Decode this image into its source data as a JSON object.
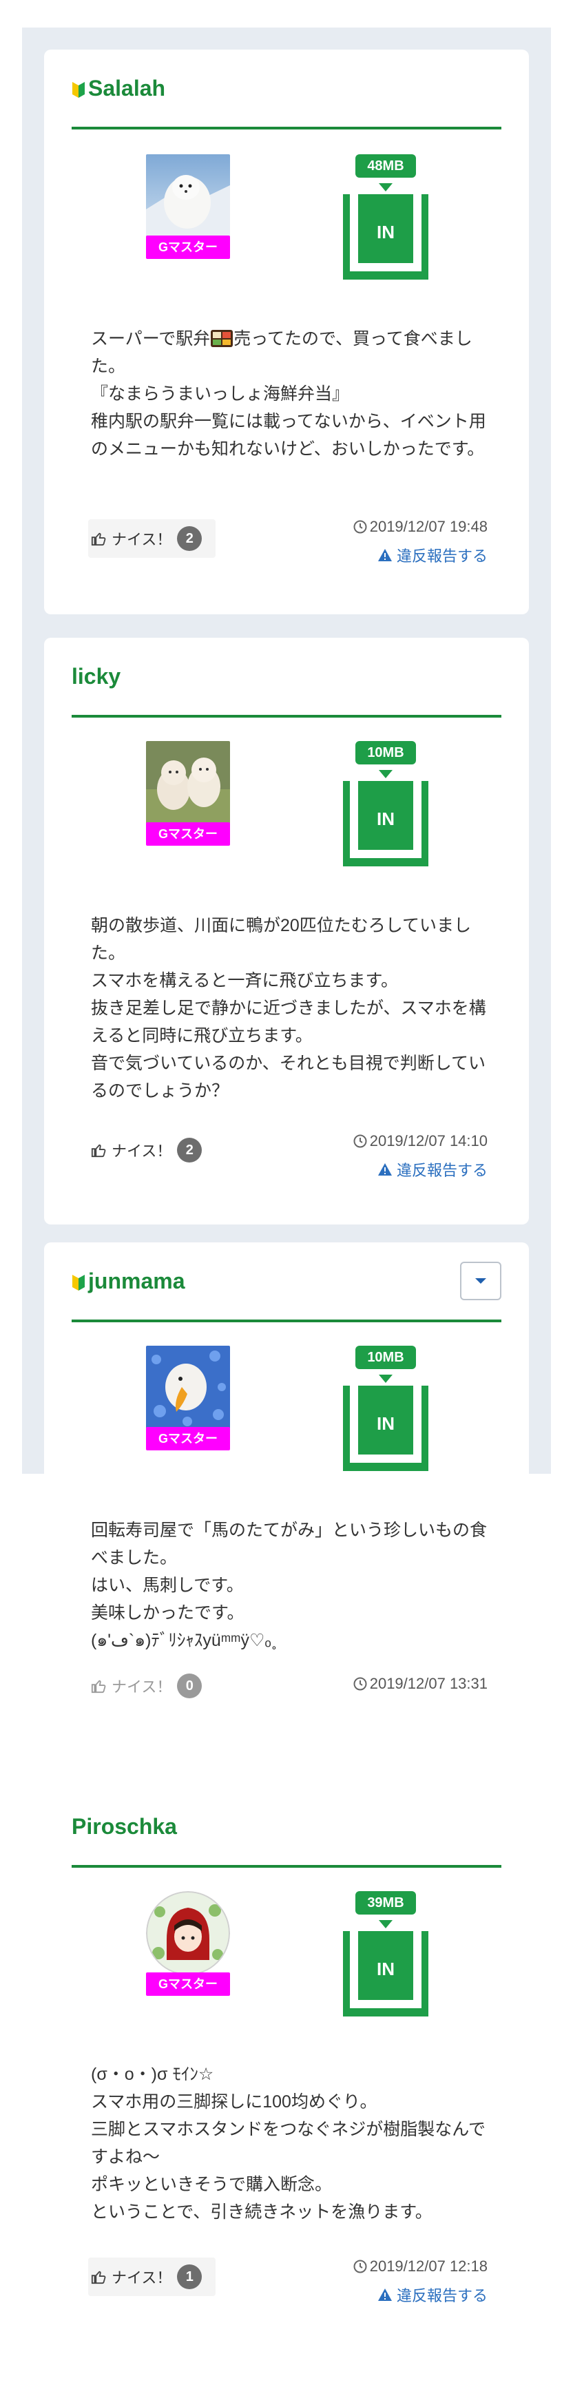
{
  "colors": {
    "accent_green": "#1b8a3a",
    "in_green": "#1e9e48",
    "badge_magenta": "#ff00ff",
    "link_blue": "#2b6fbf",
    "feed_background": "#e7ecf2"
  },
  "posts": [
    {
      "username": "Salalah",
      "beginner_mark": true,
      "rank": "Gマスター",
      "size": "48MB",
      "status": "IN",
      "body_pre_emoji": "スーパーで駅弁",
      "body_emoji_icon": "bento-box-icon",
      "body_post_emoji": "売ってたので、買って食べました。\n『なまらうまいっしょ海鮮弁当』\n稚内駅の駅弁一覧には載ってないから、イベント用のメニューかも知れないけど、おいしかったです。",
      "nice_label": "ナイス！",
      "nice_count": "2",
      "timestamp": "2019/12/07 19:48",
      "report_label": "違反報告する"
    },
    {
      "username": "licky",
      "beginner_mark": false,
      "rank": "Gマスター",
      "size": "10MB",
      "status": "IN",
      "body": "朝の散歩道、川面に鴨が20匹位たむろしていました。\nスマホを構えると一斉に飛び立ちます。\n抜き足差し足で静かに近づきましたが、スマホを構えると同時に飛び立ちます。\n音で気づいているのか、それとも目視で判断しているのでしょうか？",
      "nice_label": "ナイス！",
      "nice_count": "2",
      "timestamp": "2019/12/07 14:10",
      "report_label": "違反報告する"
    },
    {
      "username": "junmama",
      "beginner_mark": true,
      "rank": "Gマスター",
      "size": "10MB",
      "status": "IN",
      "body": "回転寿司屋で「馬のたてがみ」という珍しいもの食べました。\nはい、馬刺しです。\n美味しかったです。\n(๑'ڡ`๑)ﾃﾞﾘｼｬｽyüᵐᵐÿ♡ₒ˳",
      "nice_label": "ナイス！",
      "nice_count": "0",
      "timestamp": "2019/12/07 13:31"
    },
    {
      "username": "Piroschka",
      "beginner_mark": false,
      "rank": "Gマスター",
      "size": "39MB",
      "status": "IN",
      "body": "(σ・o・)σ ﾓｲﾝ☆\nスマホ用の三脚探しに100均めぐり。\n三脚とスマホスタンドをつなぐネジが樹脂製なんですよね〜\nポキッといきそうで購入断念。\nということで、引き続きネットを漁ります。",
      "nice_label": "ナイス！",
      "nice_count": "1",
      "timestamp": "2019/12/07 12:18",
      "report_label": "違反報告する"
    }
  ]
}
